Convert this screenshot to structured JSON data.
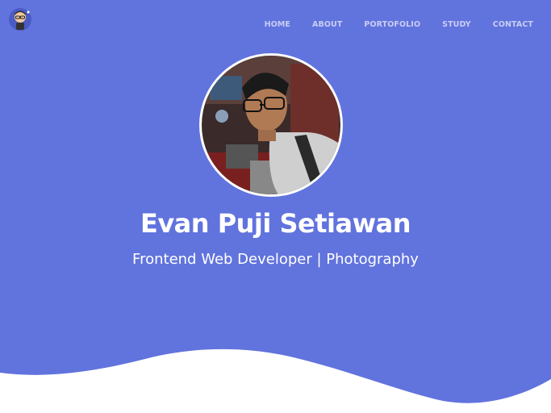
{
  "nav": {
    "logo_icon": "avatar-cartoon-icon",
    "items": [
      {
        "label": "HOME"
      },
      {
        "label": "ABOUT"
      },
      {
        "label": "PORTOFOLIO"
      },
      {
        "label": "STUDY"
      },
      {
        "label": "CONTACT"
      }
    ]
  },
  "hero": {
    "name": "Evan Puji Setiawan",
    "tagline": "Frontend Web Developer | Photography",
    "background_color": "#6173dd"
  }
}
